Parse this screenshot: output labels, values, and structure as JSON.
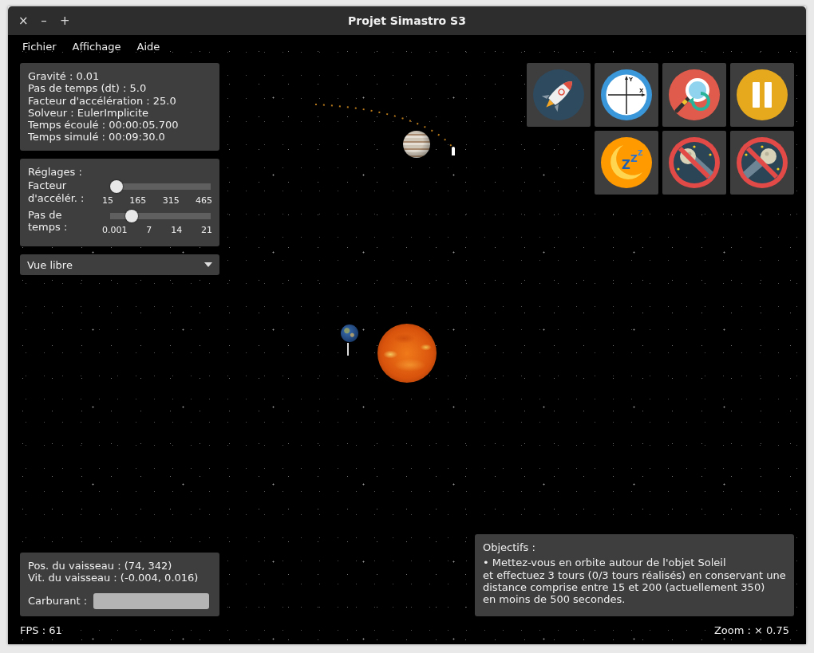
{
  "window": {
    "title": "Projet Simastro S3",
    "controls": [
      "×",
      "–",
      "+"
    ]
  },
  "menu": [
    "Fichier",
    "Affichage",
    "Aide"
  ],
  "info_panel": [
    "Gravité : 0.01",
    "Pas de temps (dt) : 5.0",
    "Facteur d'accélération : 25.0",
    "Solveur : EulerImplicite",
    "Temps écoulé : 00:00:05.700",
    "Temps simulé : 00:09:30.0"
  ],
  "settings": {
    "title": "Réglages :",
    "sliders": [
      {
        "label": "Facteur\nd'accélér. :",
        "level": 0,
        "ticks": [
          "15",
          "165",
          "315",
          "465"
        ]
      },
      {
        "label": "Pas de\ntemps :",
        "level": 0.17,
        "ticks": [
          "0.001",
          "7",
          "14",
          "21"
        ]
      }
    ]
  },
  "view_select": {
    "value": "Vue libre"
  },
  "toolbar": [
    {
      "kind": "rocket"
    },
    {
      "kind": "axes",
      "letters": [
        "Y",
        "X"
      ]
    },
    {
      "kind": "zoom-reset"
    },
    {
      "kind": "pause"
    },
    {
      "kind": "sleep",
      "letters": [
        "Z",
        "Z",
        "Z"
      ]
    },
    {
      "kind": "no-asteroid"
    },
    {
      "kind": "no-asteroid-mirrored"
    }
  ],
  "ship_panel": {
    "lines": [
      "Pos. du vaisseau : (74, 342)",
      "Vit. du vaisseau : (-0.004, 0.016)"
    ],
    "fuel_label": "Carburant :",
    "fuel": {
      "level": 1
    }
  },
  "objectives": {
    "title": "Objectifs :",
    "text": "• Mettez-vous en orbite autour de l'objet Soleil\net effectuez 3 tours (0/3 tours réalisés) en conservant une\ndistance comprise entre 15 et 200 (actuellement 350)\nen moins de 500 secondes."
  },
  "status": {
    "fps": "FPS : 61",
    "zoom": "Zoom : × 0.75"
  }
}
